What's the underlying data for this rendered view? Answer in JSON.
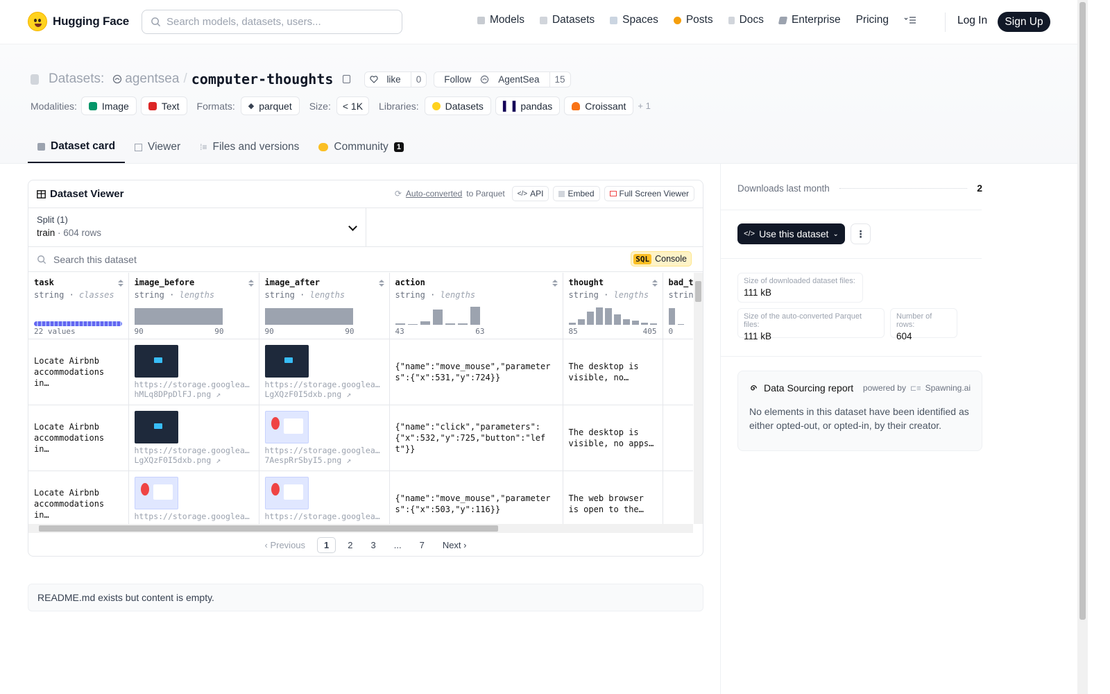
{
  "nav": {
    "brand": "Hugging Face",
    "search_placeholder": "Search models, datasets, users...",
    "links": [
      "Models",
      "Datasets",
      "Spaces",
      "Posts",
      "Docs",
      "Enterprise",
      "Pricing"
    ],
    "login": "Log In",
    "signup": "Sign Up"
  },
  "header": {
    "kind_label": "Datasets:",
    "org": "agentsea",
    "separator": "/",
    "name": "computer-thoughts",
    "like_label": "like",
    "like_count": "0",
    "follow_label": "Follow",
    "follow_org": "AgentSea",
    "follow_count": "15",
    "modalities_label": "Modalities:",
    "modalities": [
      "Image",
      "Text"
    ],
    "formats_label": "Formats:",
    "format": "parquet",
    "size_label": "Size:",
    "size": "< 1K",
    "libraries_label": "Libraries:",
    "libraries": [
      "Datasets",
      "pandas",
      "Croissant"
    ],
    "libraries_more": "+ 1"
  },
  "tabs": [
    "Dataset card",
    "Viewer",
    "Files and versions",
    "Community"
  ],
  "community_count": "1",
  "viewer": {
    "title": "Dataset Viewer",
    "auto_converted": "Auto-converted",
    "to_parquet": "to Parquet",
    "api": "API",
    "embed": "Embed",
    "fullscreen": "Full Screen Viewer",
    "split_label": "Split (1)",
    "split_name": "train",
    "split_rows": "604 rows",
    "search_placeholder": "Search this dataset",
    "sql_tag": "SQL",
    "sql_label": "Console",
    "columns": [
      {
        "name": "task",
        "type": "string",
        "stat": "classes",
        "range_left": "22 values",
        "range_right": ""
      },
      {
        "name": "image_before",
        "type": "string",
        "stat": "lengths",
        "range_left": "90",
        "range_right": "90"
      },
      {
        "name": "image_after",
        "type": "string",
        "stat": "lengths",
        "range_left": "90",
        "range_right": "90"
      },
      {
        "name": "action",
        "type": "string",
        "stat": "lengths",
        "range_left": "43",
        "range_right": "63"
      },
      {
        "name": "thought",
        "type": "string",
        "stat": "lengths",
        "range_left": "85",
        "range_right": "405"
      },
      {
        "name": "bad_t",
        "type": "strin",
        "stat": "",
        "range_left": "0",
        "range_right": ""
      }
    ],
    "rows": [
      {
        "task": "Locate Airbnb accommodations in…",
        "before_url": "https://storage.googleap…",
        "before_file": "hMLq8DPpDlFJ.png ↗",
        "after_url": "https://storage.googleap…",
        "after_file": "LgXQzF0I5dxb.png ↗",
        "action": "{\"name\":\"move_mouse\",\"parameters\":{\"x\":531,\"y\":724}}",
        "thought": "The desktop is visible, no…"
      },
      {
        "task": "Locate Airbnb accommodations in…",
        "before_url": "https://storage.googleap…",
        "before_file": "LgXQzF0I5dxb.png ↗",
        "after_url": "https://storage.googleap…",
        "after_file": "7AespRrSbyI5.png ↗",
        "action": "{\"name\":\"click\",\"parameters\":{\"x\":532,\"y\":725,\"button\":\"left\"}}",
        "thought": "The desktop is visible, no apps…"
      },
      {
        "task": "Locate Airbnb accommodations in…",
        "before_url": "https://storage.googleap…",
        "before_file": "",
        "after_url": "https://storage.googleap…",
        "after_file": "",
        "action": "{\"name\":\"move_mouse\",\"parameters\":{\"x\":503,\"y\":116}}",
        "thought": "The web browser is open to the…"
      }
    ],
    "pager": {
      "prev": "Previous",
      "pages": [
        "1",
        "2",
        "3",
        "...",
        "7"
      ],
      "next": "Next"
    }
  },
  "readme": "README.md exists but content is empty.",
  "sidebar": {
    "downloads_label": "Downloads last month",
    "downloads": "2",
    "use_button": "Use this dataset",
    "more": "⋮",
    "stats": [
      {
        "label": "Size of downloaded dataset files:",
        "value": "111 kB"
      },
      {
        "label": "Size of the auto-converted Parquet files:",
        "value": "111 kB"
      },
      {
        "label": "Number of rows:",
        "value": "604"
      }
    ],
    "report_title": "Data Sourcing report",
    "powered_by": "powered by",
    "provider": "Spawning.ai",
    "report_body": "No elements in this dataset have been identified as either opted-out, or opted-in, by their creator."
  },
  "colors": {
    "brand_yellow": "#ffd21e",
    "dark": "#111827",
    "accent": "#6366f1"
  }
}
